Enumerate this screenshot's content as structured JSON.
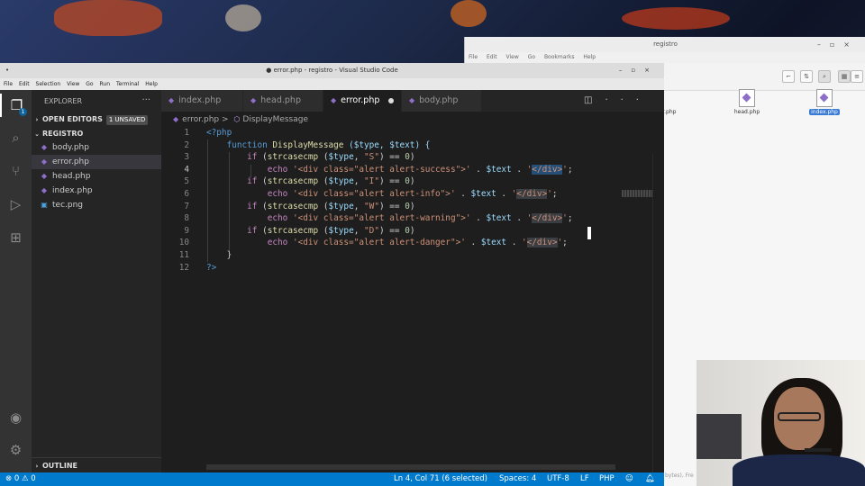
{
  "filemanager": {
    "title": "registro",
    "menu": [
      "File",
      "Edit",
      "View",
      "Go",
      "Bookmarks",
      "Help"
    ],
    "files": [
      {
        "name": "or.php",
        "selected": false
      },
      {
        "name": "head.php",
        "selected": false
      },
      {
        "name": "index.php",
        "selected": true
      }
    ],
    "status_partial": "bytes), Fre"
  },
  "vscode": {
    "title": "● error.php - registro - Visual Studio Code",
    "menu": [
      "File",
      "Edit",
      "Selection",
      "View",
      "Go",
      "Run",
      "Terminal",
      "Help"
    ],
    "activity": {
      "explorer_badge": "1"
    },
    "sidebar": {
      "header": "EXPLORER",
      "open_editors": "OPEN EDITORS",
      "unsaved_badge": "1 UNSAVED",
      "folder": "REGISTRO",
      "files": [
        "body.php",
        "error.php",
        "head.php",
        "index.php",
        "tec.png"
      ],
      "outline": "OUTLINE"
    },
    "tabs": [
      "index.php",
      "head.php",
      "error.php",
      "body.php"
    ],
    "breadcrumb": {
      "file": "error.php",
      "separator": ">",
      "symbol": "DisplayMessage"
    },
    "code_lines": [
      "1",
      "2",
      "3",
      "4",
      "5",
      "6",
      "7",
      "8",
      "9",
      "10",
      "11",
      "12"
    ],
    "code": {
      "l1": "<?php",
      "l2_fn": "function",
      "l2_name": "DisplayMessage",
      "l2_params": " ($type, $text) {",
      "if": "if",
      "strcasecmp": "strcasecmp",
      "echo": "echo",
      "type_var": "$type",
      "text_var": "$text",
      "s_type": "\"S\"",
      "i_type": "\"I\"",
      "w_type": "\"W\"",
      "d_type": "\"D\"",
      "zero": "0",
      "div_success": "'<div class=\"alert alert-success\">'",
      "div_info": "'<div class=\"alert alert-info\">'",
      "div_warning": "'<div class=\"alert alert-warning\">'",
      "div_danger": "'<div class=\"alert alert-danger\">'",
      "close_div": "</div>",
      "close_brace": "}",
      "l12": "?>"
    },
    "status": {
      "errors": "0",
      "warnings": "0",
      "position": "Ln 4, Col 71 (6 selected)",
      "spaces": "Spaces: 4",
      "encoding": "UTF-8",
      "eol": "LF",
      "language": "PHP"
    }
  }
}
